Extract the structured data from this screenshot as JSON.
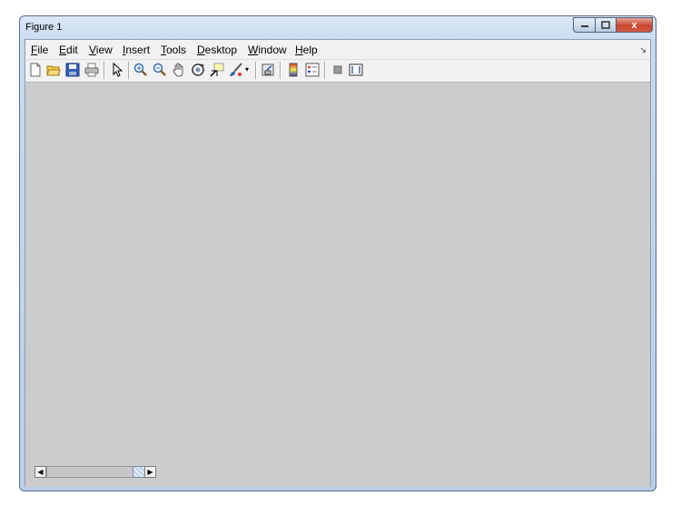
{
  "window": {
    "title": "Figure 1",
    "close_glyph": "x"
  },
  "menubar": {
    "items": [
      {
        "label": "File",
        "mnemonic": "F",
        "rest": "ile"
      },
      {
        "label": "Edit",
        "mnemonic": "E",
        "rest": "dit"
      },
      {
        "label": "View",
        "mnemonic": "V",
        "rest": "iew"
      },
      {
        "label": "Insert",
        "mnemonic": "I",
        "rest": "nsert"
      },
      {
        "label": "Tools",
        "mnemonic": "T",
        "rest": "ools"
      },
      {
        "label": "Desktop",
        "mnemonic": "D",
        "rest": "esktop"
      },
      {
        "label": "Window",
        "mnemonic": "W",
        "rest": "indow"
      },
      {
        "label": "Help",
        "mnemonic": "H",
        "rest": "elp"
      }
    ],
    "dock_glyph": "↘"
  },
  "toolbar": {
    "icons": [
      "new-figure-icon",
      "open-file-icon",
      "save-figure-icon",
      "print-figure-icon",
      "edit-plot-icon",
      "zoom-in-icon",
      "zoom-out-icon",
      "pan-icon",
      "rotate-3d-icon",
      "data-cursor-icon",
      "brush-icon",
      "brush-dropdown-icon",
      "link-plot-icon",
      "insert-colorbar-icon",
      "insert-legend-icon",
      "hide-plot-tools-icon",
      "show-plot-tools-icon"
    ]
  },
  "colors": {
    "canvas": "#cccccc",
    "chrome": "#f0f0f0",
    "title_bar": "#c7daee"
  },
  "scrollbar": {
    "left_glyph": "◀",
    "right_glyph": "▶"
  }
}
